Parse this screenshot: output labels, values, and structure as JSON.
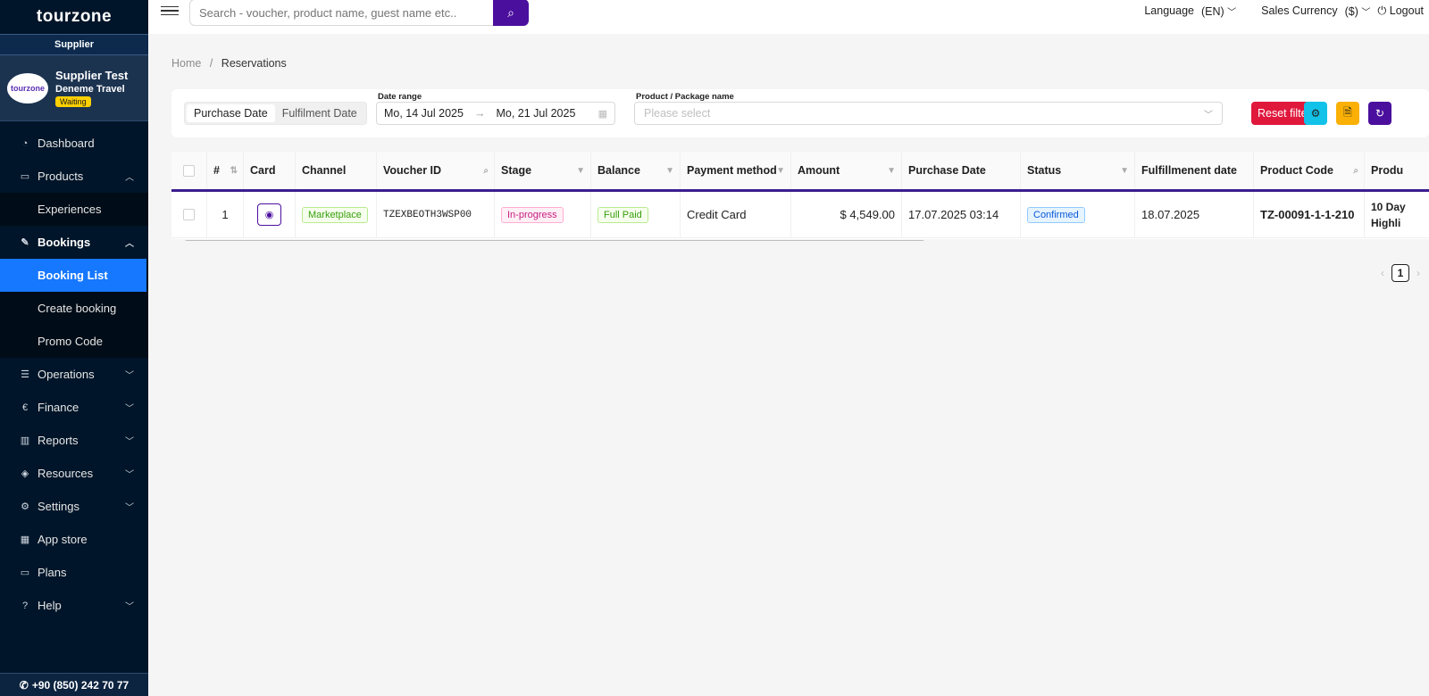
{
  "brand": {
    "logo_text": "tourzone",
    "role": "Supplier"
  },
  "profile": {
    "name": "Supplier Test",
    "company": "Deneme Travel",
    "status": "Waiting",
    "avatar_text": "tourzone"
  },
  "menu": [
    {
      "label": "Dashboard",
      "icon": "dashboard-icon"
    },
    {
      "label": "Products",
      "icon": "products-icon",
      "expanded": true,
      "children": [
        {
          "label": "Experiences"
        }
      ]
    },
    {
      "label": "Bookings",
      "icon": "bookings-icon",
      "expanded": true,
      "children": [
        {
          "label": "Booking List",
          "active": true
        },
        {
          "label": "Create booking"
        },
        {
          "label": "Promo Code"
        }
      ]
    },
    {
      "label": "Operations",
      "icon": "operations-icon"
    },
    {
      "label": "Finance",
      "icon": "finance-icon"
    },
    {
      "label": "Reports",
      "icon": "reports-icon"
    },
    {
      "label": "Resources",
      "icon": "resources-icon"
    },
    {
      "label": "Settings",
      "icon": "settings-icon"
    },
    {
      "label": "App store",
      "icon": "app-store-icon"
    },
    {
      "label": "Plans",
      "icon": "plans-icon"
    },
    {
      "label": "Help",
      "icon": "help-icon"
    }
  ],
  "labels": {
    "dashboard": "Dashboard",
    "products": "Products",
    "experiences": "Experiences",
    "bookings": "Bookings",
    "booking_list": "Booking List",
    "create_booking": "Create booking",
    "promo_code": "Promo Code",
    "operations": "Operations",
    "finance": "Finance",
    "reports": "Reports",
    "resources": "Resources",
    "settings": "Settings",
    "app_store": "App store",
    "plans": "Plans",
    "help": "Help"
  },
  "phone": "+90 (850) 242 70 77",
  "header": {
    "search_placeholder": "Search - voucher, product name, guest name etc..",
    "language_label": "Language",
    "language_value": "(EN)",
    "currency_label": "Sales Currency",
    "currency_value": "($)",
    "logout": "Logout"
  },
  "breadcrumb": {
    "home": "Home",
    "sep": "/",
    "current": "Reservations"
  },
  "filters": {
    "date_type_options": [
      "Purchase Date",
      "Fulfilment Date"
    ],
    "date_type_selected": "Purchase Date",
    "date_range_label": "Date range",
    "date_from": "Mo, 14 Jul 2025",
    "date_to": "Mo, 21 Jul 2025",
    "product_label": "Product / Package name",
    "product_placeholder": "Please select",
    "reset_label": "Reset filter"
  },
  "colors": {
    "brand": "#4b0f9e",
    "reset": "#e0183c",
    "settings_btn": "#13c2e8",
    "export_btn": "#fab005",
    "refresh_btn": "#4b0f9e",
    "active_menu": "#1677ff"
  },
  "table": {
    "columns": [
      "#",
      "Card",
      "Channel",
      "Voucher ID",
      "Stage",
      "Balance",
      "Payment method",
      "Amount",
      "Purchase Date",
      "Status",
      "Fulfillmenent date",
      "Product Code",
      "Produ"
    ],
    "rows": [
      {
        "index": "1",
        "channel": "Marketplace",
        "voucher_id": "TZEXBEOTH3WSP00",
        "stage": "In-progress",
        "balance": "Full Paid",
        "payment_method": "Credit Card",
        "amount": "$ 4,549.00",
        "purchase_date": "17.07.2025 03:14",
        "status": "Confirmed",
        "fulfillment_date": "18.07.2025",
        "product_code": "TZ-00091-1-1-210",
        "product_line1": "10 Day",
        "product_line2": "Highli"
      }
    ]
  },
  "pagination": {
    "current": "1"
  }
}
